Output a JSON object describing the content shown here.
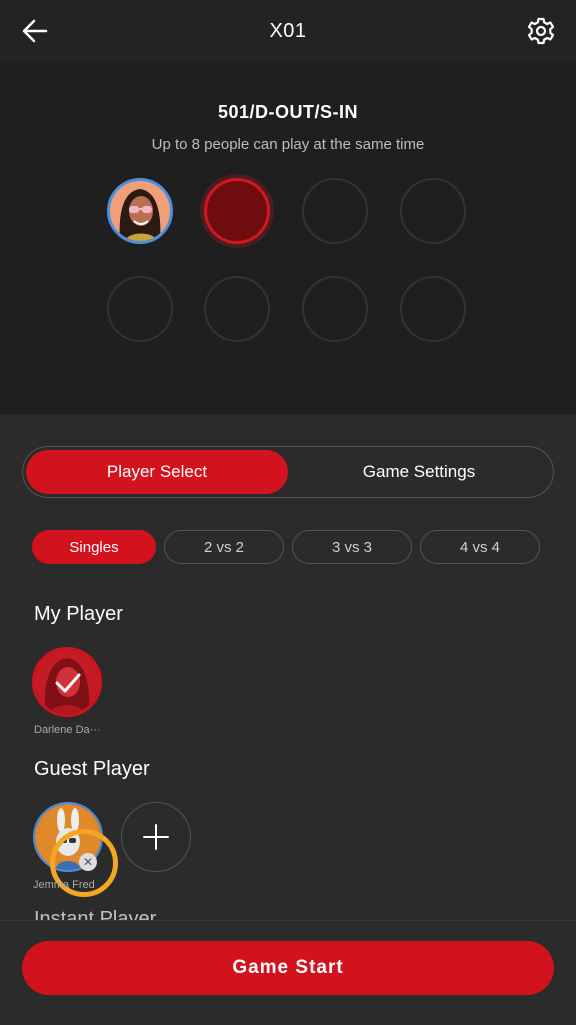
{
  "header": {
    "title": "X01",
    "back_icon": "arrow-left-icon",
    "settings_icon": "gear-icon"
  },
  "game": {
    "name": "501/D-OUT/S-IN",
    "description": "Up to 8 people can play at the same time"
  },
  "tabs": [
    {
      "label": "Player Select",
      "selected": true
    },
    {
      "label": "Game Settings",
      "selected": false
    }
  ],
  "modes": [
    {
      "label": "Singles",
      "selected": true
    },
    {
      "label": "2 vs 2",
      "selected": false
    },
    {
      "label": "3 vs 3",
      "selected": false
    },
    {
      "label": "4 vs 4",
      "selected": false
    }
  ],
  "my_player": {
    "section_title": "My Player",
    "players": [
      {
        "name": "Darlene Da···",
        "selected": true
      }
    ]
  },
  "guest_player": {
    "section_title": "Guest Player",
    "players": [
      {
        "name": "Jemma Fred"
      }
    ]
  },
  "next_section_partial": "Instant Player",
  "start_button": "Game Start",
  "colors": {
    "accent": "#d2121d",
    "highlight": "#f5a623",
    "avatar_border": "#4a90e2"
  }
}
